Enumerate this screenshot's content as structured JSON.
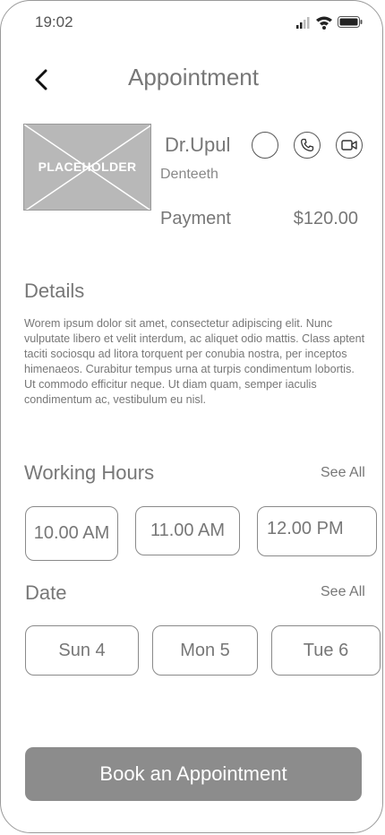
{
  "status_bar": {
    "time": "19:02",
    "icons": [
      "signal-icon",
      "wifi-icon",
      "battery-icon"
    ]
  },
  "header": {
    "title": "Appointment",
    "back_icon": "chevron-left-icon"
  },
  "doctor": {
    "image_placeholder": "PLACEHOLDER",
    "name": "Dr.Upul",
    "specialty": "Denteeth",
    "actions": [
      "status-circle",
      "phone-icon",
      "video-icon"
    ],
    "payment_label": "Payment",
    "payment_value": "$120.00"
  },
  "details": {
    "title": "Details",
    "body": "Worem ipsum dolor sit amet, consectetur adipiscing elit. Nunc vulputate libero et velit interdum, ac aliquet odio mattis. Class aptent taciti sociosqu ad litora torquent per conubia nostra, per inceptos himenaeos. Curabitur tempus urna at turpis condimentum lobortis. Ut commodo efficitur neque. Ut diam quam, semper iaculis condimentum ac, vestibulum eu nisl."
  },
  "working_hours": {
    "title": "Working Hours",
    "see_all": "See All",
    "slots": [
      "10.00 AM",
      "11.00 AM",
      "12.00 PM"
    ]
  },
  "date": {
    "title": "Date",
    "see_all": "See All",
    "days": [
      "Sun 4",
      "Mon 5",
      "Tue 6"
    ]
  },
  "book_button": "Book an Appointment",
  "colors": {
    "text": "#777777",
    "border": "#8a8a8a",
    "button_bg": "#8c8c8c",
    "placeholder_bg": "#b8b8b8"
  }
}
